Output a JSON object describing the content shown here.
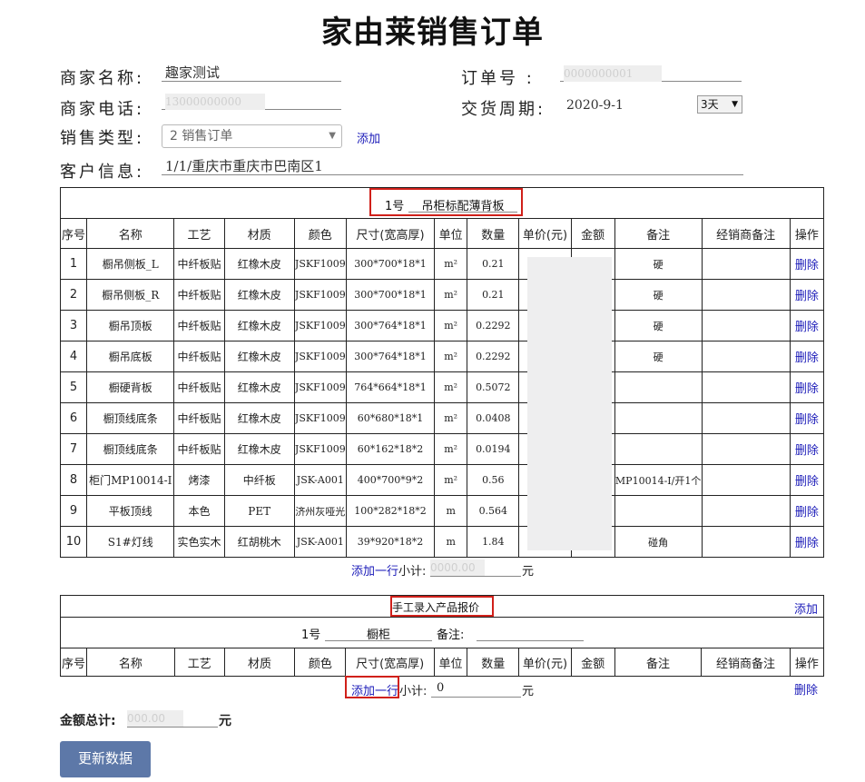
{
  "page": {
    "title": "家由莱销售订单"
  },
  "merchant": {
    "name_label": "商家名称:",
    "name_value": "趣家测试",
    "phone_label": "商家电话:",
    "phone_value": "13000000000",
    "sale_type_label": "销售类型:",
    "sale_type_value": "2 销售订单",
    "add_label": "添加",
    "customer_label": "客户信息:",
    "customer_value": "1/1/重庆市重庆市巴南区1"
  },
  "order": {
    "number_label": "订单号 :",
    "number_value": "0000000001",
    "delivery_label": "交货周期:",
    "delivery_value": "2020-9-1",
    "period_value": "3天"
  },
  "section1": {
    "number": "1号",
    "name": "吊柜标配薄背板",
    "headers": [
      "序号",
      "名称",
      "工艺",
      "材质",
      "颜色",
      "尺寸(宽高厚)",
      "单位",
      "数量",
      "单价(元)",
      "金额",
      "备注",
      "经销商备注",
      "操作"
    ],
    "rows": [
      [
        "1",
        "橱吊侧板_L",
        "中纤板贴",
        "红橡木皮",
        "JSKF1009",
        "300*700*18*1",
        "m²",
        "0.21",
        "",
        "",
        "硬",
        "",
        "删除"
      ],
      [
        "2",
        "橱吊侧板_R",
        "中纤板贴",
        "红橡木皮",
        "JSKF1009",
        "300*700*18*1",
        "m²",
        "0.21",
        "",
        "",
        "硬",
        "",
        "删除"
      ],
      [
        "3",
        "橱吊顶板",
        "中纤板贴",
        "红橡木皮",
        "JSKF1009",
        "300*764*18*1",
        "m²",
        "0.2292",
        "",
        "",
        "硬",
        "",
        "删除"
      ],
      [
        "4",
        "橱吊底板",
        "中纤板贴",
        "红橡木皮",
        "JSKF1009",
        "300*764*18*1",
        "m²",
        "0.2292",
        "",
        "",
        "硬",
        "",
        "删除"
      ],
      [
        "5",
        "橱硬背板",
        "中纤板贴",
        "红橡木皮",
        "JSKF1009",
        "764*664*18*1",
        "m²",
        "0.5072",
        "",
        "",
        "",
        "",
        "删除"
      ],
      [
        "6",
        "橱顶线底条",
        "中纤板贴",
        "红橡木皮",
        "JSKF1009",
        "60*680*18*1",
        "m²",
        "0.0408",
        "",
        "",
        "",
        "",
        "删除"
      ],
      [
        "7",
        "橱顶线底条",
        "中纤板贴",
        "红橡木皮",
        "JSKF1009",
        "60*162*18*2",
        "m²",
        "0.0194",
        "",
        "",
        "",
        "",
        "删除"
      ],
      [
        "8",
        "柜门MP10014-I",
        "烤漆",
        "中纤板",
        "JSK-A001",
        "400*700*9*2",
        "m²",
        "0.56",
        "",
        "",
        "MP10014-I/开1个",
        "",
        "删除"
      ],
      [
        "9",
        "平板顶线",
        "本色",
        "PET",
        "济州灰哑光",
        "100*282*18*2",
        "m",
        "0.564",
        "",
        "",
        "",
        "",
        "删除"
      ],
      [
        "10",
        "S1#灯线",
        "实色实木",
        "红胡桃木",
        "JSK-A001",
        "39*920*18*2",
        "m",
        "1.84",
        "",
        "",
        "碰角",
        "",
        "删除"
      ]
    ],
    "add_row_label": "添加一行",
    "subtotal_label": "小计:",
    "subtotal_value": "0000.00",
    "unit": "元"
  },
  "section2": {
    "title": "手工录入产品报价",
    "add_label": "添加",
    "number": "1号",
    "name": "橱柜",
    "remark_label": "备注:",
    "remark_value": "",
    "headers": [
      "序号",
      "名称",
      "工艺",
      "材质",
      "颜色",
      "尺寸(宽高厚)",
      "单位",
      "数量",
      "单价(元)",
      "金额",
      "备注",
      "经销商备注",
      "操作"
    ],
    "add_row_label": "添加一行",
    "subtotal_label": "小计:",
    "subtotal_value": "0",
    "unit": "元",
    "delete_label": "删除"
  },
  "total": {
    "label": "金额总计:",
    "value": "000.00",
    "unit": "元"
  },
  "update_button": "更新数据",
  "colors": {
    "accent_button": "#5d78a8",
    "highlight": "#d0201a",
    "link": "#1a1ab8"
  }
}
